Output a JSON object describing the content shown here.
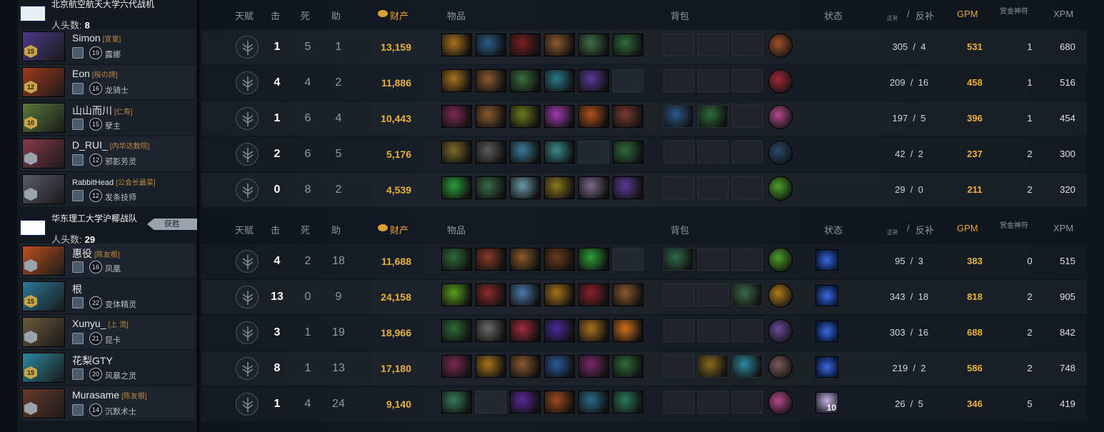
{
  "headers": {
    "talent": "天赋",
    "kills": "击",
    "deaths": "死",
    "assists": "助",
    "networth": "财产",
    "items": "物品",
    "backpack": "背包",
    "status": "状态",
    "lasthits": "正补",
    "slash": "/",
    "denies": "反补",
    "gpm": "GPM",
    "bounty": "赏金神符",
    "xpm": "XPM"
  },
  "teams": [
    {
      "name": "北京航空航天大学六代战机",
      "kills_label": "人头数:",
      "kills": "8",
      "logo": "shield-logo"
    },
    {
      "name": "华东理工大学沪椰战队",
      "kills_label": "人头数:",
      "kills": "29",
      "logo": "cup-logo",
      "result": "获胜"
    }
  ],
  "players": [
    {
      "name": "Simon",
      "tag": "[宜皇]",
      "level": "15",
      "rank": "19",
      "hero": "露娜",
      "k": "1",
      "d": "5",
      "a": "1",
      "nw": "13,159",
      "lh": "305",
      "dn": "4",
      "gpm": "531",
      "bounty": "1",
      "xpm": "680"
    },
    {
      "name": "Eon",
      "tag": "[桜の詩]",
      "level": "12",
      "rank": "16",
      "hero": "龙骑士",
      "k": "4",
      "d": "4",
      "a": "2",
      "nw": "11,886",
      "lh": "209",
      "dn": "16",
      "gpm": "458",
      "bounty": "1",
      "xpm": "516"
    },
    {
      "name": "山山而川",
      "tag": "[仁寿]",
      "level": "10",
      "rank": "15",
      "hero": "孽主",
      "k": "1",
      "d": "6",
      "a": "4",
      "nw": "10,443",
      "lh": "197",
      "dn": "5",
      "gpm": "396",
      "bounty": "1",
      "xpm": "454"
    },
    {
      "name": "D_RUI_",
      "tag": "[内华达数院]",
      "level": "",
      "rank": "12",
      "hero": "邪影芳灵",
      "k": "2",
      "d": "6",
      "a": "5",
      "nw": "5,176",
      "lh": "42",
      "dn": "2",
      "gpm": "237",
      "bounty": "2",
      "xpm": "300"
    },
    {
      "name": "RabbitHead",
      "tag": "[公会长最菜]",
      "level": "",
      "rank": "12",
      "hero": "发条技师",
      "k": "0",
      "d": "8",
      "a": "2",
      "nw": "4,539",
      "lh": "29",
      "dn": "0",
      "gpm": "211",
      "bounty": "2",
      "xpm": "320"
    },
    {
      "name": "惠役",
      "tag": "[陈友根]",
      "level": "",
      "rank": "16",
      "hero": "凤凰",
      "k": "4",
      "d": "2",
      "a": "18",
      "nw": "11,688",
      "lh": "95",
      "dn": "3",
      "gpm": "383",
      "bounty": "0",
      "xpm": "515"
    },
    {
      "name": "根",
      "tag": "",
      "level": "15",
      "rank": "22",
      "hero": "变体精灵",
      "k": "13",
      "d": "0",
      "a": "9",
      "nw": "24,158",
      "lh": "343",
      "dn": "18",
      "gpm": "818",
      "bounty": "2",
      "xpm": "905"
    },
    {
      "name": "Xunyu_",
      "tag": "[上 流]",
      "level": "",
      "rank": "21",
      "hero": "昆卡",
      "k": "3",
      "d": "1",
      "a": "19",
      "nw": "18,966",
      "lh": "303",
      "dn": "16",
      "gpm": "688",
      "bounty": "2",
      "xpm": "842"
    },
    {
      "name": "花梨GTY",
      "tag": "",
      "level": "15",
      "rank": "20",
      "hero": "风暴之灵",
      "k": "8",
      "d": "1",
      "a": "13",
      "nw": "17,180",
      "lh": "219",
      "dn": "2",
      "gpm": "586",
      "bounty": "2",
      "xpm": "748"
    },
    {
      "name": "Murasame",
      "tag": "[陈友根]",
      "level": "",
      "rank": "14",
      "hero": "沉默术士",
      "k": "1",
      "d": "4",
      "a": "24",
      "nw": "9,140",
      "lh": "26",
      "dn": "5",
      "gpm": "346",
      "bounty": "5",
      "xpm": "419"
    }
  ],
  "buff_count": "10",
  "colors": {
    "gold": "#e8b23a",
    "accent": "#e8a23c",
    "panel": "#141920"
  }
}
